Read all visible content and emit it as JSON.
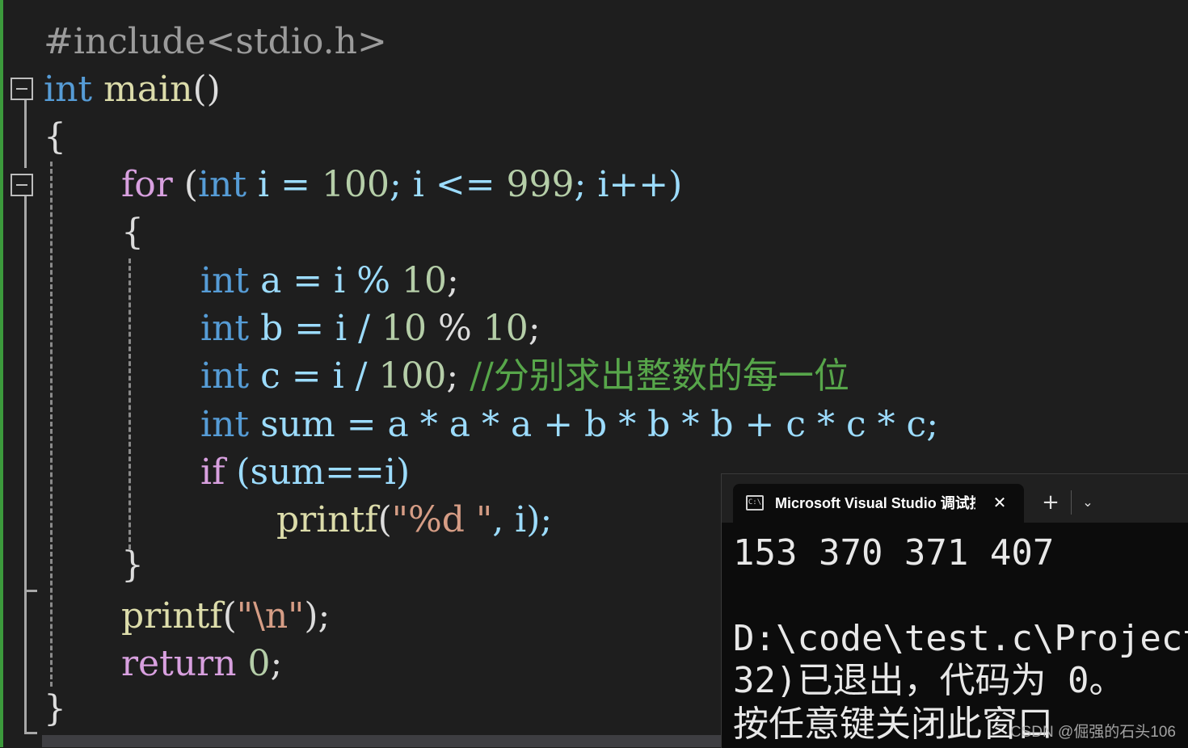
{
  "code": {
    "include": "#include<stdio.h>",
    "main_sig": {
      "kw": "int",
      "name": "main",
      "parens": "()"
    },
    "open_brace": "{",
    "for_line": {
      "kw_for": "for",
      "open": " (",
      "kw_int": "int",
      "p1": " i = ",
      "n1": "100",
      "p2": "; i <= ",
      "n2": "999",
      "p3": "; i++)"
    },
    "for_open": "{",
    "decl_a": {
      "kw": "int",
      "rest": " a = i % ",
      "num": "10",
      "end": ";"
    },
    "decl_b": {
      "kw": "int",
      "rest1": " b = i / ",
      "num1": "10",
      "rest2": " % ",
      "num2": "10",
      "end": ";"
    },
    "decl_c": {
      "kw": "int",
      "rest": " c = i / ",
      "num": "100",
      "end": "; ",
      "comment": "//分别求出整数的每一位"
    },
    "decl_sum": {
      "kw": "int",
      "rest": " sum = a * a * a + b * b * b + c * c * c;"
    },
    "if_line": {
      "kw": "if",
      "rest": " (sum==i)"
    },
    "printf1": {
      "fn": "printf",
      "open": "(",
      "str": "\"%d \"",
      "rest": ", i);"
    },
    "for_close": "}",
    "printf2": {
      "fn": "printf",
      "open": "(",
      "str": "\"\\n\"",
      "rest": ");"
    },
    "return_line": {
      "kw": "return",
      "num": "0",
      "end": ";"
    },
    "close_brace": "}"
  },
  "console": {
    "tab_title": "Microsoft Visual Studio 调试控制台",
    "tab_icon": "C:\\",
    "close_glyph": "✕",
    "new_tab_glyph": "+",
    "dropdown_glyph": "⌄",
    "output_line": "153 370 371 407",
    "lines": [
      "D:\\code\\test.c\\Project",
      "32)已退出，代码为 0。",
      "按任意键关闭此窗口"
    ],
    "watermark": "CSDN @倔强的石头106"
  }
}
